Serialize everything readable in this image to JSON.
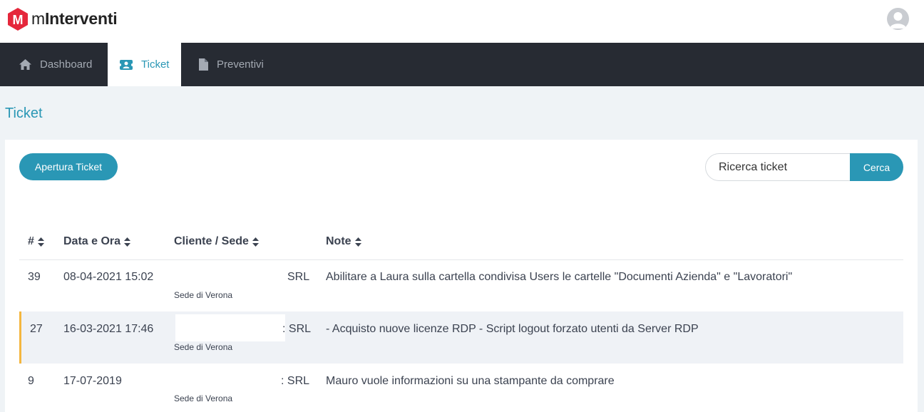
{
  "app": {
    "brand_prefix": "m",
    "brand_name": "Interventi",
    "logo_letter": "M"
  },
  "nav": {
    "dashboard": "Dashboard",
    "ticket": "Ticket",
    "preventivi": "Preventivi"
  },
  "page": {
    "title": "Ticket"
  },
  "toolbar": {
    "open_ticket": "Apertura Ticket",
    "search_placeholder": "Ricerca ticket",
    "search_button": "Cerca"
  },
  "table": {
    "headers": {
      "id": "#",
      "datetime": "Data e Ora",
      "client": "Cliente / Sede",
      "note": "Note"
    },
    "rows": [
      {
        "id": "39",
        "datetime": "08-04-2021 15:02",
        "client": "SRL",
        "sede": "Sede di Verona",
        "note": "Abilitare a Laura sulla cartella condivisa Users le cartelle \"Documenti Azienda\" e \"Lavoratori\""
      },
      {
        "id": "27",
        "datetime": "16-03-2021 17:46",
        "client": ": SRL",
        "sede": "Sede di Verona",
        "note": "- Acquisto nuove licenze RDP - Script logout forzato utenti da Server RDP"
      },
      {
        "id": "9",
        "datetime": "17-07-2019",
        "client": ": SRL",
        "sede": "Sede di Verona",
        "note": "Mauro vuole informazioni su una stampante da comprare"
      }
    ]
  },
  "colors": {
    "accent": "#2a97b5",
    "navbar": "#272b33",
    "highlight": "#f4b63f",
    "logo": "#e5273b"
  }
}
